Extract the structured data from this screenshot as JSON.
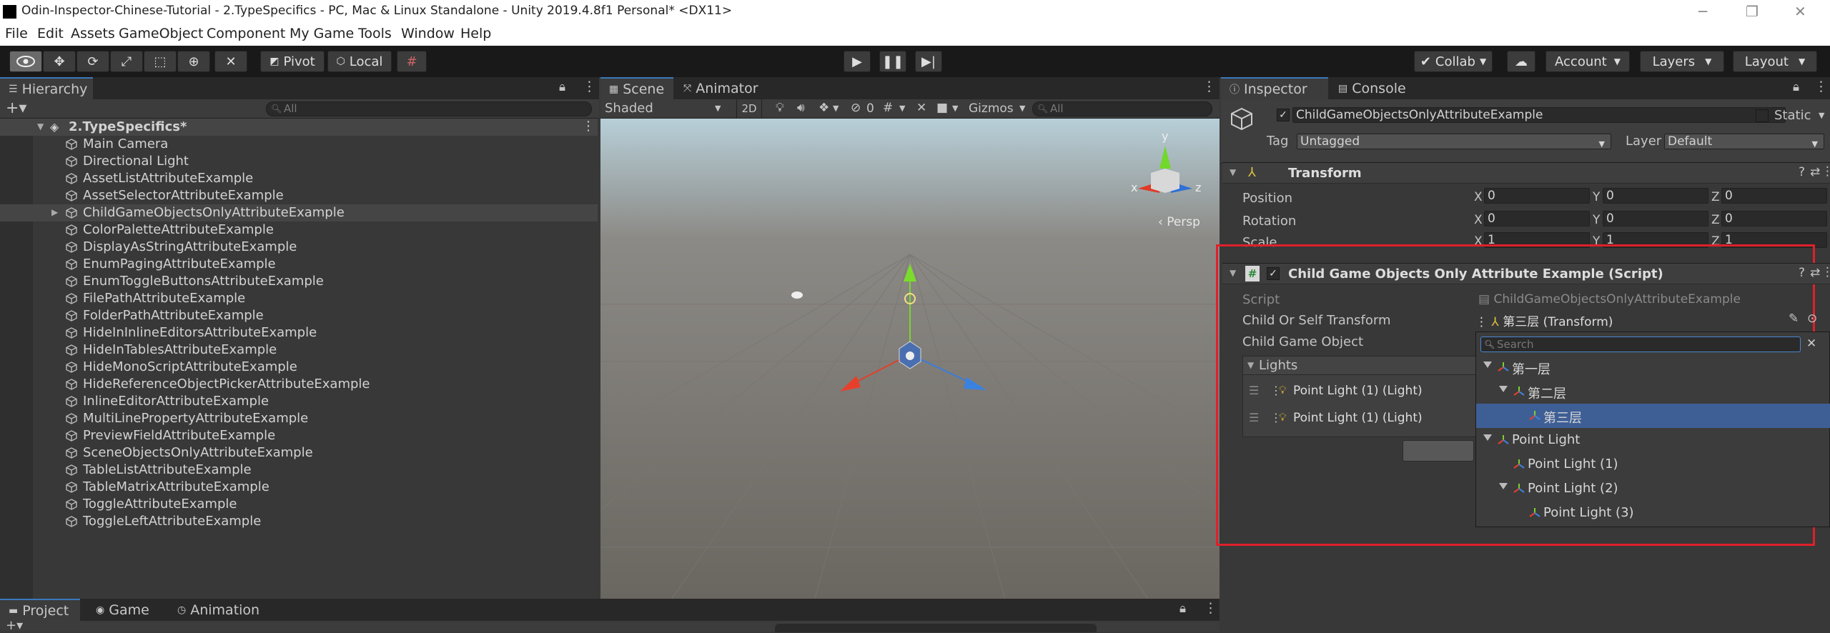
{
  "window": {
    "title": "Odin-Inspector-Chinese-Tutorial - 2.TypeSpecifics - PC, Mac & Linux Standalone - Unity 2019.4.8f1 Personal* <DX11>"
  },
  "menu": [
    "File",
    "Edit",
    "Assets",
    "GameObject",
    "Component",
    "My Game",
    "Tools",
    "Window",
    "Help"
  ],
  "toolbar": {
    "pivot_label": "Pivot",
    "local_label": "Local",
    "collab_label": "Collab",
    "account_label": "Account",
    "layers_label": "Layers",
    "layout_label": "Layout"
  },
  "hierarchy": {
    "tab_label": "Hierarchy",
    "search_placeholder": "All",
    "scene_name": "2.TypeSpecifics*",
    "items": [
      "Main Camera",
      "Directional Light",
      "AssetListAttributeExample",
      "AssetSelectorAttributeExample",
      "ChildGameObjectsOnlyAttributeExample",
      "ColorPaletteAttributeExample",
      "DisplayAsStringAttributeExample",
      "EnumPagingAttributeExample",
      "EnumToggleButtonsAttributeExample",
      "FilePathAttributeExample",
      "FolderPathAttributeExample",
      "HideInInlineEditorsAttributeExample",
      "HideInTablesAttributeExample",
      "HideMonoScriptAttributeExample",
      "HideReferenceObjectPickerAttributeExample",
      "InlineEditorAttributeExample",
      "MultiLinePropertyAttributeExample",
      "PreviewFieldAttributeExample",
      "SceneObjectsOnlyAttributeExample",
      "TableListAttributeExample",
      "TableMatrixAttributeExample",
      "ToggleAttributeExample",
      "ToggleLeftAttributeExample"
    ]
  },
  "scene": {
    "tabs": [
      "Scene",
      "Animator"
    ],
    "shading_mode": "Shaded",
    "mode_2d": "2D",
    "hidden_count": "0",
    "gizmos_label": "Gizmos",
    "search_placeholder": "All",
    "persp_label": "Persp",
    "axis_labels": {
      "x": "x",
      "y": "y",
      "z": "z"
    }
  },
  "inspector": {
    "tabs": [
      "Inspector",
      "Console"
    ],
    "object_name": "ChildGameObjectsOnlyAttributeExample",
    "static_label": "Static",
    "tag_label": "Tag",
    "tag_value": "Untagged",
    "layer_label": "Layer",
    "layer_value": "Default",
    "transform": {
      "title": "Transform",
      "position_label": "Position",
      "rotation_label": "Rotation",
      "scale_label": "Scale",
      "position": [
        "0",
        "0",
        "0"
      ],
      "rotation": [
        "0",
        "0",
        "0"
      ],
      "scale": [
        "1",
        "1",
        "1"
      ],
      "axes": [
        "X",
        "Y",
        "Z"
      ]
    },
    "script_component": {
      "title": "Child Game Objects Only Attribute Example (Script)",
      "script_label": "Script",
      "script_value": "ChildGameObjectsOnlyAttributeExample",
      "child_or_self_label": "Child Or Self Transform",
      "child_or_self_value": "第三层 (Transform)",
      "child_go_label": "Child Game Object",
      "lights_label": "Lights",
      "light_items": [
        "Point Light (1) (Light)",
        "Point Light (1) (Light)"
      ]
    }
  },
  "dropdown": {
    "search_placeholder": "Search",
    "items": [
      {
        "label": "第一层",
        "depth": 0,
        "expanded": true,
        "selected": false
      },
      {
        "label": "第二层",
        "depth": 1,
        "expanded": true,
        "selected": false
      },
      {
        "label": "第三层",
        "depth": 2,
        "expanded": false,
        "selected": true
      },
      {
        "label": "Point Light",
        "depth": 0,
        "expanded": true,
        "selected": false
      },
      {
        "label": "Point Light (1)",
        "depth": 1,
        "expanded": false,
        "selected": false
      },
      {
        "label": "Point Light (2)",
        "depth": 1,
        "expanded": true,
        "selected": false
      },
      {
        "label": "Point Light (3)",
        "depth": 2,
        "expanded": false,
        "selected": false
      }
    ]
  },
  "bottom": {
    "tabs": [
      "Project",
      "Game",
      "Animation"
    ]
  },
  "colors": {
    "accent": "#3a79bb",
    "selection": "#3e5f96",
    "highlight_box": "#e0202a",
    "panel_bg": "#383838"
  }
}
